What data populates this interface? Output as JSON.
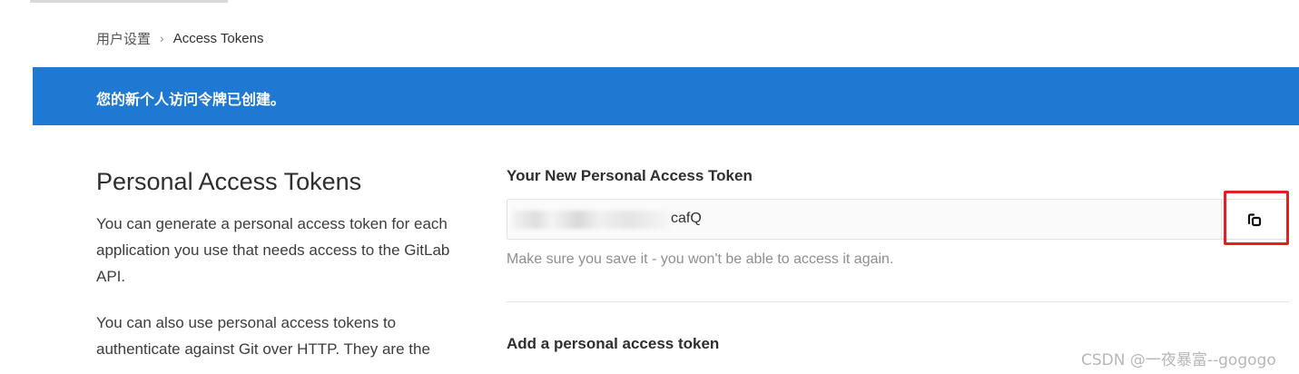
{
  "breadcrumb": {
    "parent": "用户设置",
    "separator": "›",
    "current": "Access Tokens"
  },
  "flash": {
    "message": "您的新个人访问令牌已创建。",
    "color": "#1f78d1"
  },
  "left": {
    "title": "Personal Access Tokens",
    "paragraph1": "You can generate a personal access token for each application you use that needs access to the GitLab API.",
    "paragraph2": "You can also use personal access tokens to authenticate against Git over HTTP. They are the"
  },
  "right": {
    "new_token_label": "Your New Personal Access Token",
    "token_value_visible": "cafQ",
    "copy_icon": "copy-icon",
    "helper_text": "Make sure you save it - you won't be able to access it again.",
    "add_token_title": "Add a personal access token"
  },
  "watermark": "CSDN @一夜暴富--gogogo",
  "colors": {
    "accent_blue": "#1f78d1",
    "annotation_red": "#e32020"
  }
}
